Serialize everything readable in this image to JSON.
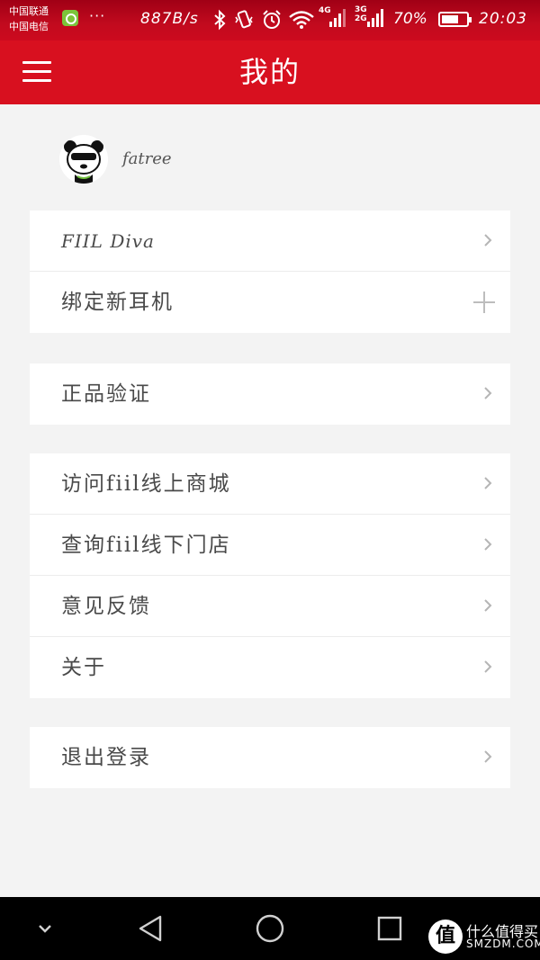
{
  "status_bar": {
    "carrier_1": "中国联通",
    "carrier_2": "中国电信",
    "more": "···",
    "net_speed": "887B/s",
    "network_4g": "4G",
    "network_3g": "3G",
    "network_2g": "2G",
    "battery_percent": "70%",
    "battery_level": 0.7,
    "time": "20:03"
  },
  "header": {
    "title": "我的",
    "menu_icon": "hamburger-menu-icon",
    "background": "#d8101f"
  },
  "profile": {
    "username": "fatree",
    "avatar": "panda-avatar"
  },
  "groups": [
    {
      "items": [
        {
          "label": "FIIL  Diva",
          "action": "chevron"
        },
        {
          "label": "绑定新耳机",
          "action": "plus"
        }
      ]
    },
    {
      "items": [
        {
          "label": "正品验证",
          "action": "chevron"
        }
      ]
    },
    {
      "items": [
        {
          "label": "访问fiil线上商城",
          "action": "chevron"
        },
        {
          "label": "查询fiil线下门店",
          "action": "chevron"
        },
        {
          "label": "意见反馈",
          "action": "chevron"
        },
        {
          "label": "关于",
          "action": "chevron"
        }
      ]
    },
    {
      "items": [
        {
          "label": "退出登录",
          "action": "chevron"
        }
      ]
    }
  ],
  "nav_bar": {
    "buttons": [
      "collapse-icon",
      "back-icon",
      "home-icon",
      "recents-icon"
    ]
  },
  "watermark": {
    "logo_char": "值",
    "text_cn": "什么值得买",
    "text_en": "SMZDM.COM"
  }
}
